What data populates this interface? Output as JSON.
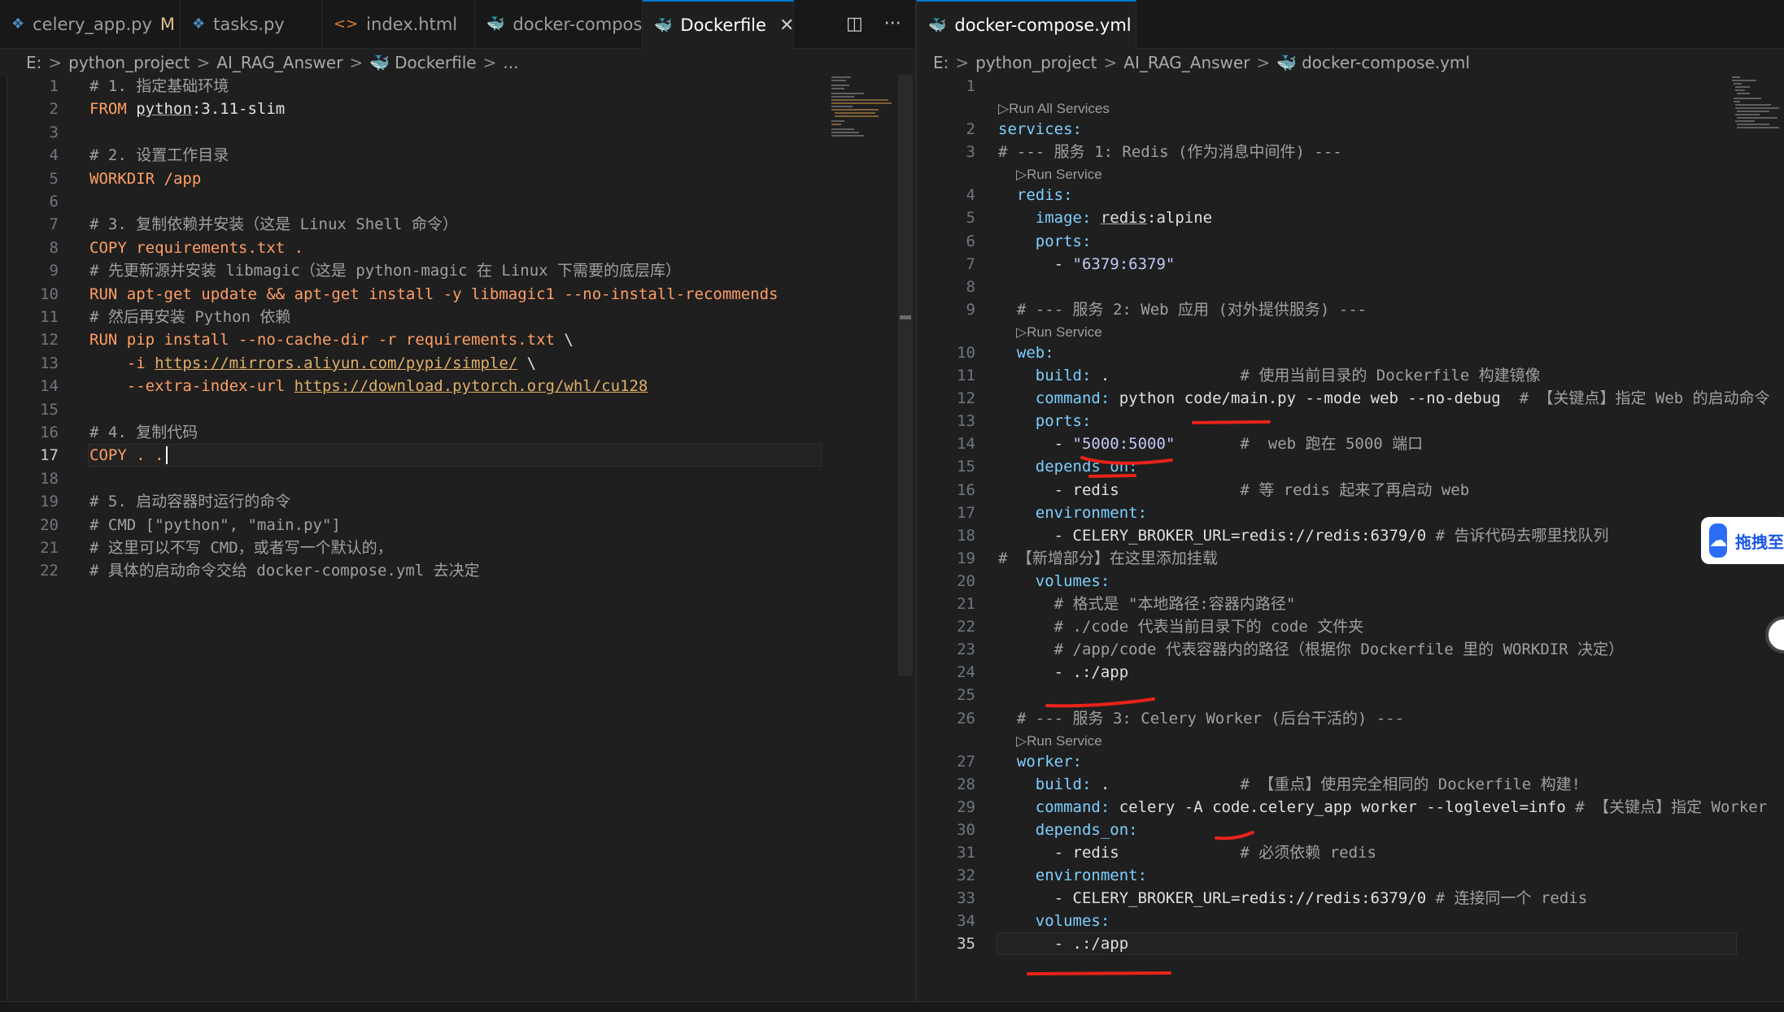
{
  "left_editor": {
    "tabs": [
      {
        "label": "celery_app.py",
        "icon": "python-file-icon",
        "modified": "M"
      },
      {
        "label": "tasks.py",
        "icon": "python-file-icon"
      },
      {
        "label": "index.html",
        "icon": "html-file-icon"
      },
      {
        "label": "docker-compose.yml",
        "icon": "docker-file-icon"
      },
      {
        "label": "Dockerfile",
        "icon": "docker-file-icon",
        "active": true,
        "close": "✕"
      }
    ],
    "tools": {
      "split": "◫",
      "more": "···"
    },
    "breadcrumb": [
      "E:",
      "python_project",
      "AI_RAG_Answer",
      "Dockerfile",
      "..."
    ],
    "lines": [
      {
        "n": "1",
        "parts": [
          [
            "c-com",
            "# 1. 指定基础环境"
          ]
        ]
      },
      {
        "n": "2",
        "parts": [
          [
            "c-kw",
            "FROM "
          ],
          [
            "c-val u",
            "python"
          ],
          [
            "c-val",
            ":3.11-slim"
          ]
        ]
      },
      {
        "n": "3",
        "parts": []
      },
      {
        "n": "4",
        "parts": [
          [
            "c-com",
            "# 2. 设置工作目录"
          ]
        ]
      },
      {
        "n": "5",
        "parts": [
          [
            "c-kw",
            "WORKDIR /app"
          ]
        ]
      },
      {
        "n": "6",
        "parts": []
      },
      {
        "n": "7",
        "parts": [
          [
            "c-com",
            "# 3. 复制依赖并安装（这是 Linux Shell 命令）"
          ]
        ]
      },
      {
        "n": "8",
        "parts": [
          [
            "c-kw",
            "COPY requirements.txt ."
          ]
        ]
      },
      {
        "n": "9",
        "parts": [
          [
            "c-com",
            "# 先更新源并安装 libmagic（这是 python-magic 在 Linux 下需要的底层库）"
          ]
        ]
      },
      {
        "n": "10",
        "parts": [
          [
            "c-kw",
            "RUN apt-get update && apt-get install -y libmagic1 --no-install-recommends"
          ]
        ]
      },
      {
        "n": "11",
        "parts": [
          [
            "c-com",
            "# 然后再安装 Python 依赖"
          ]
        ]
      },
      {
        "n": "12",
        "parts": [
          [
            "c-kw",
            "RUN pip install --no-cache-dir -r requirements.txt "
          ],
          [
            "c-val",
            "\\"
          ]
        ]
      },
      {
        "n": "13",
        "parts": [
          [
            "c-kw",
            "    -i "
          ],
          [
            "c-link",
            "https://mirrors.aliyun.com/pypi/simple/"
          ],
          [
            "c-val",
            " \\"
          ]
        ]
      },
      {
        "n": "14",
        "parts": [
          [
            "c-kw",
            "    --extra-index-url "
          ],
          [
            "c-link",
            "https://download.pytorch.org/whl/cu128"
          ]
        ]
      },
      {
        "n": "15",
        "parts": []
      },
      {
        "n": "16",
        "parts": [
          [
            "c-com",
            "# 4. 复制代码"
          ]
        ]
      },
      {
        "n": "17",
        "parts": [
          [
            "c-kw",
            "COPY . ."
          ]
        ],
        "current": true
      },
      {
        "n": "18",
        "parts": []
      },
      {
        "n": "19",
        "parts": [
          [
            "c-com",
            "# 5. 启动容器时运行的命令"
          ]
        ]
      },
      {
        "n": "20",
        "parts": [
          [
            "c-com",
            "# CMD [\"python\", \"main.py\"]"
          ]
        ]
      },
      {
        "n": "21",
        "parts": [
          [
            "c-com",
            "# 这里可以不写 CMD，或者写一个默认的，"
          ]
        ]
      },
      {
        "n": "22",
        "parts": [
          [
            "c-com",
            "# 具体的启动命令交给 docker-compose.yml 去决定"
          ]
        ]
      }
    ]
  },
  "right_editor": {
    "tabs": [
      {
        "label": "docker-compose.yml",
        "icon": "docker-file-icon",
        "active": true,
        "close": "✕"
      }
    ],
    "breadcrumb": [
      "E:",
      "python_project",
      "AI_RAG_Answer",
      "docker-compose.yml"
    ],
    "lines": [
      {
        "n": "1",
        "parts": []
      },
      {
        "lens": "▷Run All Services",
        "indent": 0
      },
      {
        "n": "2",
        "parts": [
          [
            "c-key",
            "services:"
          ]
        ]
      },
      {
        "n": "3",
        "parts": [
          [
            "c-com",
            "# --- 服务 1: Redis (作为消息中间件) ---"
          ]
        ]
      },
      {
        "lens": "▷Run Service",
        "indent": 1
      },
      {
        "n": "4",
        "parts": [
          [
            "c-key",
            "  redis:"
          ]
        ]
      },
      {
        "n": "5",
        "parts": [
          [
            "c-key",
            "    image: "
          ],
          [
            "c-val u",
            "redis"
          ],
          [
            "c-val",
            ":alpine"
          ]
        ]
      },
      {
        "n": "6",
        "parts": [
          [
            "c-key",
            "    ports:"
          ]
        ]
      },
      {
        "n": "7",
        "parts": [
          [
            "c-val",
            "      - "
          ],
          [
            "c-q",
            "\"6379:6379\""
          ]
        ]
      },
      {
        "n": "8",
        "parts": []
      },
      {
        "n": "9",
        "parts": [
          [
            "c-com",
            "  # --- 服务 2: Web 应用 (对外提供服务) ---"
          ]
        ]
      },
      {
        "lens": "▷Run Service",
        "indent": 1
      },
      {
        "n": "10",
        "parts": [
          [
            "c-key",
            "  web:"
          ]
        ]
      },
      {
        "n": "11",
        "parts": [
          [
            "c-key",
            "    build: "
          ],
          [
            "c-val",
            ".              "
          ],
          [
            "c-com",
            "# 使用当前目录的 Dockerfile 构建镜像"
          ]
        ]
      },
      {
        "n": "12",
        "parts": [
          [
            "c-key",
            "    command: "
          ],
          [
            "c-val",
            "python code/main.py --mode web --no-debug  "
          ],
          [
            "c-com",
            "# 【关键点】指定 Web 的启动命令"
          ]
        ]
      },
      {
        "n": "13",
        "parts": [
          [
            "c-key",
            "    ports:"
          ]
        ]
      },
      {
        "n": "14",
        "parts": [
          [
            "c-val",
            "      - "
          ],
          [
            "c-q",
            "\"5000:5000\""
          ],
          [
            "c-com",
            "       #  web 跑在 5000 端口"
          ]
        ]
      },
      {
        "n": "15",
        "parts": [
          [
            "c-key",
            "    depends_on:"
          ]
        ]
      },
      {
        "n": "16",
        "parts": [
          [
            "c-val",
            "      - redis             "
          ],
          [
            "c-com",
            "# 等 redis 起来了再启动 web"
          ]
        ]
      },
      {
        "n": "17",
        "parts": [
          [
            "c-key",
            "    environment:"
          ]
        ]
      },
      {
        "n": "18",
        "parts": [
          [
            "c-val",
            "      - CELERY_BROKER_URL=redis://redis:6379/0 "
          ],
          [
            "c-com",
            "# 告诉代码去哪里找队列"
          ]
        ]
      },
      {
        "n": "19",
        "parts": [
          [
            "c-com",
            "# 【新增部分】在这里添加挂载"
          ]
        ]
      },
      {
        "n": "20",
        "parts": [
          [
            "c-key",
            "    volumes:"
          ]
        ]
      },
      {
        "n": "21",
        "parts": [
          [
            "c-com",
            "      # 格式是 \"本地路径:容器内路径\""
          ]
        ]
      },
      {
        "n": "22",
        "parts": [
          [
            "c-com",
            "      # ./code 代表当前目录下的 code 文件夹"
          ]
        ]
      },
      {
        "n": "23",
        "parts": [
          [
            "c-com",
            "      # /app/code 代表容器内的路径（根据你 Dockerfile 里的 WORKDIR 决定）"
          ]
        ]
      },
      {
        "n": "24",
        "parts": [
          [
            "c-val",
            "      - .:/app"
          ]
        ]
      },
      {
        "n": "25",
        "parts": []
      },
      {
        "n": "26",
        "parts": [
          [
            "c-com",
            "  # --- 服务 3: Celery Worker (后台干活的) ---"
          ]
        ]
      },
      {
        "lens": "▷Run Service",
        "indent": 1
      },
      {
        "n": "27",
        "parts": [
          [
            "c-key",
            "  worker:"
          ]
        ]
      },
      {
        "n": "28",
        "parts": [
          [
            "c-key",
            "    build: "
          ],
          [
            "c-val",
            ".              "
          ],
          [
            "c-com",
            "# 【重点】使用完全相同的 Dockerfile 构建!"
          ]
        ]
      },
      {
        "n": "29",
        "parts": [
          [
            "c-key",
            "    command: "
          ],
          [
            "c-val",
            "celery -A code.celery_app worker --loglevel=info "
          ],
          [
            "c-com",
            "# 【关键点】指定 Worker"
          ]
        ]
      },
      {
        "n": "30",
        "parts": [
          [
            "c-key",
            "    depends_on:"
          ]
        ]
      },
      {
        "n": "31",
        "parts": [
          [
            "c-val",
            "      - redis             "
          ],
          [
            "c-com",
            "# 必须依赖 redis"
          ]
        ]
      },
      {
        "n": "32",
        "parts": [
          [
            "c-key",
            "    environment:"
          ]
        ]
      },
      {
        "n": "33",
        "parts": [
          [
            "c-val",
            "      - CELERY_BROKER_URL=redis://redis:6379/0 "
          ],
          [
            "c-com",
            "# 连接同一个 redis"
          ]
        ]
      },
      {
        "n": "34",
        "parts": [
          [
            "c-key",
            "    volumes:"
          ]
        ]
      },
      {
        "n": "35",
        "parts": [
          [
            "c-val",
            "      - .:/app"
          ]
        ],
        "current": true
      }
    ]
  },
  "floating_widget": {
    "label": "拖拽至此上传",
    "icon": "baidu-netdisk-icon"
  },
  "colors": {
    "accent": "#0078d4",
    "background": "#1f1f1f",
    "annotation": "#e8231a"
  }
}
